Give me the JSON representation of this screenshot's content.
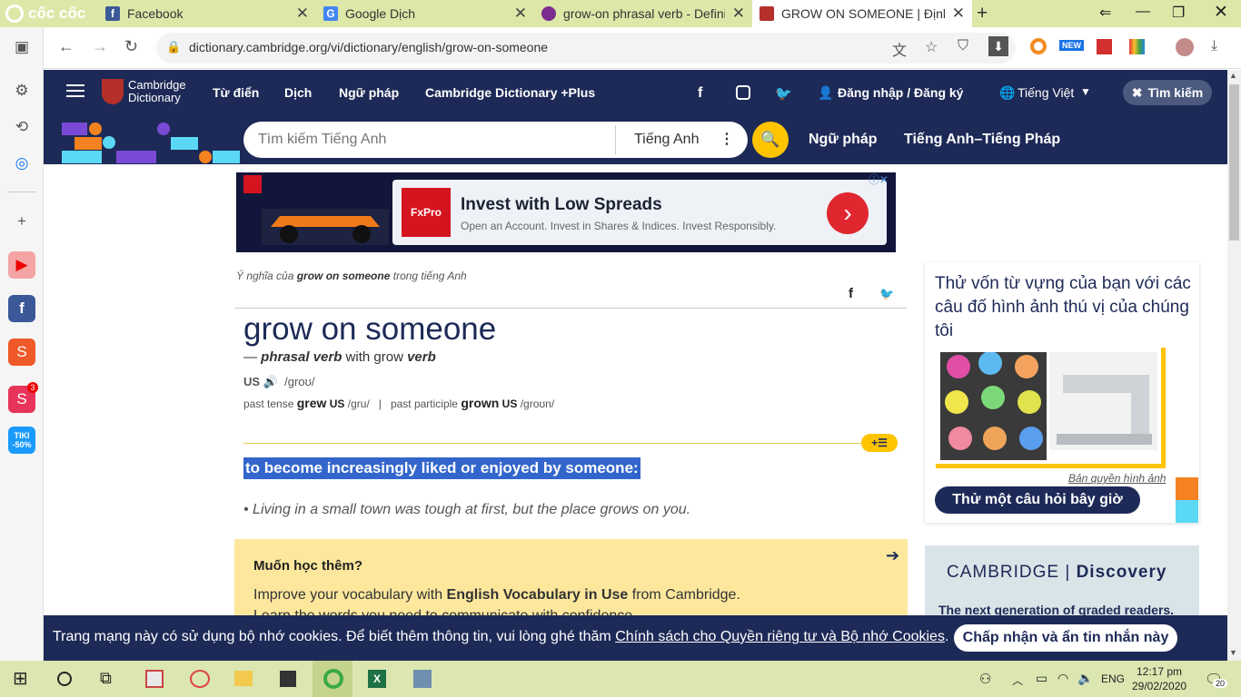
{
  "browser": {
    "brand": "cốc cốc",
    "tabs": [
      {
        "title": "Facebook",
        "icon": "facebook-icon"
      },
      {
        "title": "Google Dịch",
        "icon": "google-translate-icon"
      },
      {
        "title": "grow-on phrasal verb - Defini",
        "icon": "page-icon"
      },
      {
        "title": "GROW ON SOMEONE | Định n",
        "icon": "cambridge-icon"
      }
    ],
    "url": "dictionary.cambridge.org/vi/dictionary/english/grow-on-someone",
    "extension_badge": "NEW"
  },
  "sidebar": {
    "shopee_badge": "3",
    "tiki_label": "TIKI -50%"
  },
  "site": {
    "logo_line1": "Cambridge",
    "logo_line2": "Dictionary",
    "nav": [
      "Từ điển",
      "Dịch",
      "Ngữ pháp",
      "Cambridge Dictionary +Plus"
    ],
    "login": "Đăng nhập / Đăng ký",
    "language": "Tiếng Việt",
    "search_button": "Tìm kiếm",
    "search_placeholder": "Tìm kiếm Tiếng Anh",
    "search_dict": "Tiếng Anh",
    "subnav": [
      "Ngữ pháp",
      "Tiếng Anh–Tiếng Pháp"
    ]
  },
  "ad": {
    "brand": "FxPro",
    "title": "Invest with Low Spreads",
    "subtitle": "Open an Account. Invest in Shares & Indices. Invest Responsibly."
  },
  "entry": {
    "meaning_prefix": "Ý nghĩa của ",
    "meaning_word": "grow on someone",
    "meaning_suffix": " trong tiếng Anh",
    "headword": "grow on someone",
    "pos_dash": "— ",
    "pos": "phrasal verb",
    "pos_with": " with grow ",
    "pos_verb": "verb",
    "region": "US",
    "pronunciation": "/ɡroʊ/",
    "past_tense_label": "past tense",
    "past_tense": "grew",
    "past_tense_pron": "/ɡru/",
    "separator": "|",
    "past_participle_label": "past participle",
    "past_participle": "grown",
    "past_participle_pron": "/ɡroʊn/",
    "definition": "to become increasingly liked or enjoyed by someone:",
    "example": "• Living in a small town was tough at first, but the place grows on you."
  },
  "learn_more": {
    "title": "Muốn học thêm?",
    "text_prefix": "Improve your vocabulary with ",
    "text_bold": "English Vocabulary in Use",
    "text_suffix": " from Cambridge.",
    "text2": "Learn the words you need to communicate with confidence."
  },
  "quiz": {
    "text": "Thử vốn từ vựng của bạn với các câu đố hình ảnh thú vị của chúng tôi",
    "copyright": "Bản quyền hình ảnh",
    "button": "Thử một câu hỏi bây giờ"
  },
  "promo": {
    "brand1": "CAMBRIDGE",
    "brand2": "Discovery",
    "subtitle": "The next generation of graded readers."
  },
  "cookie": {
    "text": "Trang mạng này có sử dụng bộ nhớ cookies. Để biết thêm thông tin, vui lòng ghé thăm ",
    "link": "Chính sách cho Quyền riêng tư và Bộ nhớ Cookies",
    "end": ".",
    "button": "Chấp nhận và ẩn tin nhắn này"
  },
  "taskbar": {
    "lang": "ENG",
    "time": "12:17 pm",
    "date": "29/02/2020",
    "notifications": "20"
  }
}
